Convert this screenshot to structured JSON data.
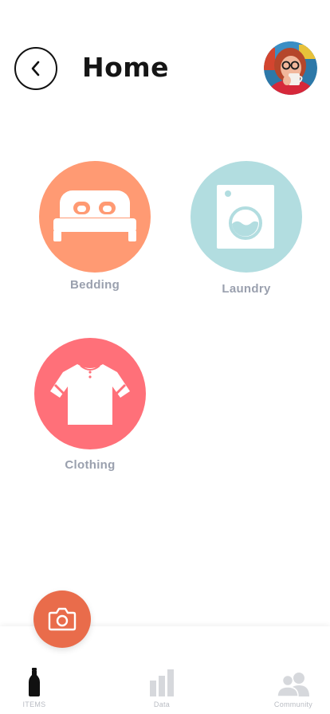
{
  "header": {
    "title": "Home"
  },
  "categories": [
    {
      "label": "Bedding",
      "icon": "bed-icon",
      "color": "#ff9a73"
    },
    {
      "label": "Laundry",
      "icon": "washing-machine-icon",
      "color": "#b2dde0"
    },
    {
      "label": "Clothing",
      "icon": "shirt-icon",
      "color": "#ff7079"
    }
  ],
  "camera": {
    "icon": "camera-icon",
    "color": "#e96c4b"
  },
  "tabbar": {
    "tabs": [
      {
        "label": "ITEMS",
        "icon": "bottle-icon",
        "active": true
      },
      {
        "label": "Data",
        "icon": "bar-chart-icon",
        "active": false
      },
      {
        "label": "Community",
        "icon": "people-icon",
        "active": false
      }
    ]
  }
}
